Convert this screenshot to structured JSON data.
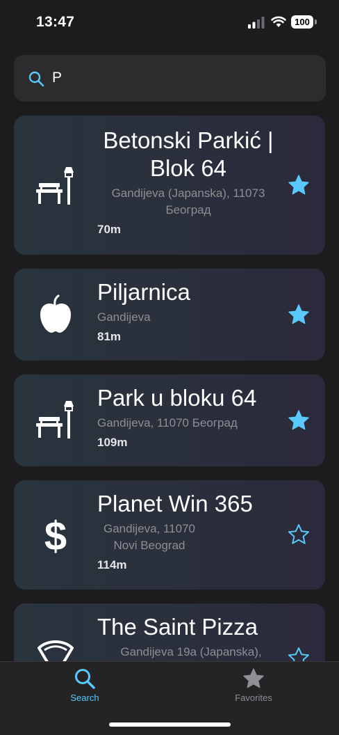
{
  "status": {
    "time": "13:47",
    "battery": "100"
  },
  "search": {
    "query": "P",
    "placeholder": ""
  },
  "results": [
    {
      "title": "Betonski Parkić | Blok 64",
      "address": "Gandijeva (Japanska), 11073 Београд",
      "distance": "70m",
      "icon": "bench-lamp-icon",
      "favorite": true
    },
    {
      "title": "Piljarnica",
      "address": "Gandijeva",
      "distance": "81m",
      "icon": "apple-icon",
      "favorite": true
    },
    {
      "title": "Park u bloku 64",
      "address": "Gandijeva, 11070 Београд",
      "distance": "109m",
      "icon": "bench-lamp-icon",
      "favorite": true
    },
    {
      "title": "Planet Win 365",
      "address": "Gandijeva, 11070 Novi Beograd",
      "distance": "114m",
      "icon": "dollar-icon",
      "favorite": false
    },
    {
      "title": "The Saint Pizza",
      "address": "Gandijeva 19a (Japanska),",
      "distance": "",
      "icon": "pizza-icon",
      "favorite": false
    }
  ],
  "tabs": [
    {
      "label": "Search",
      "icon": "search-icon",
      "active": true
    },
    {
      "label": "Favorites",
      "icon": "star-icon",
      "active": false
    }
  ],
  "colors": {
    "accent": "#5ac8fa",
    "background": "#1c1c1e",
    "card": "#2a2f3c",
    "inactive": "#8e8e93"
  }
}
